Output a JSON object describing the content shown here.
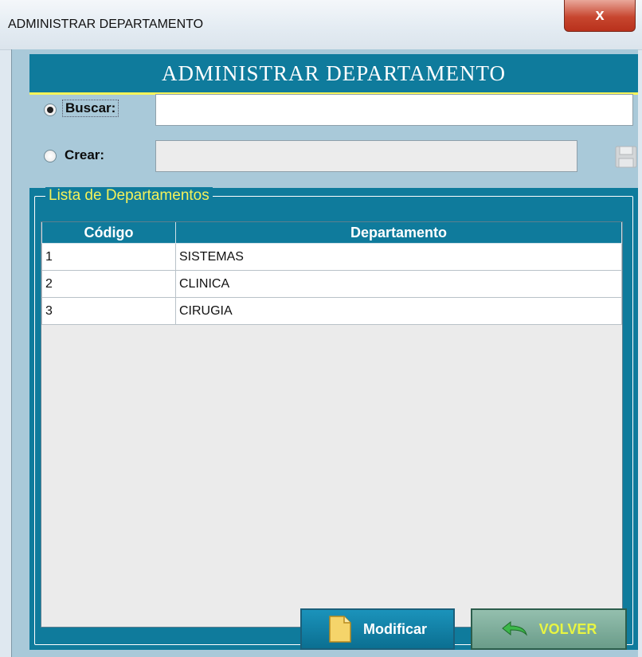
{
  "window": {
    "title": "ADMINISTRAR DEPARTAMENTO",
    "close_label": "x"
  },
  "header": {
    "title": "ADMINISTRAR DEPARTAMENTO"
  },
  "search": {
    "label": "Buscar:",
    "value": "",
    "selected": true
  },
  "create": {
    "label": "Crear:",
    "value": "",
    "selected": false
  },
  "group": {
    "title": "Lista de Departamentos"
  },
  "table": {
    "columns": [
      "Código",
      "Departamento"
    ],
    "rows": [
      [
        "1",
        "SISTEMAS"
      ],
      [
        "2",
        "CLINICA"
      ],
      [
        "3",
        "CIRUGIA"
      ]
    ]
  },
  "buttons": {
    "modify_label": "Modificar",
    "back_label": "VOLVER"
  },
  "colors": {
    "accent": "#0f7b9c",
    "title_yellow": "#f4f25a",
    "panel": "#a9c9d9"
  }
}
